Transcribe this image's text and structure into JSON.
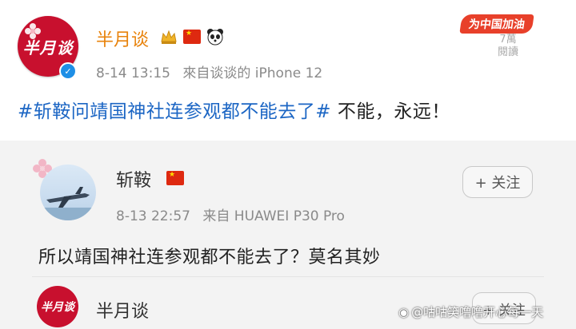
{
  "post": {
    "username": "半月谈",
    "avatar_text": "半月谈",
    "timestamp": "8-14 13:15",
    "source": "來自谈谈的 iPhone 12",
    "promo_badge": "为中国加油",
    "read_count": "7萬",
    "read_label": "閱讀",
    "topic": "#斩鞍问靖国神社连参观都不能去了#",
    "body": " 不能，永远！"
  },
  "repost": {
    "username": "斩鞍",
    "timestamp": "8-13 22:57",
    "source": "来自 HUAWEI P30 Pro",
    "follow_label": "+ 关注",
    "text": "所以靖国神社连参观都不能去了？莫名其妙"
  },
  "comment": {
    "username": "半月谈",
    "avatar_text": "半月谈",
    "follow_label": "+ 关注"
  },
  "watermark": "@咕咕笑噜噜开心每一天",
  "icons": {
    "verified": "verified-check-icon",
    "crown": "crown-badge-icon",
    "flag": "china-flag-icon",
    "panda": "panda-icon"
  },
  "colors": {
    "brand_red": "#c8102e",
    "username_orange": "#e8830c",
    "topic_blue": "#1c66c4",
    "verified_blue": "#1e8fe6"
  }
}
